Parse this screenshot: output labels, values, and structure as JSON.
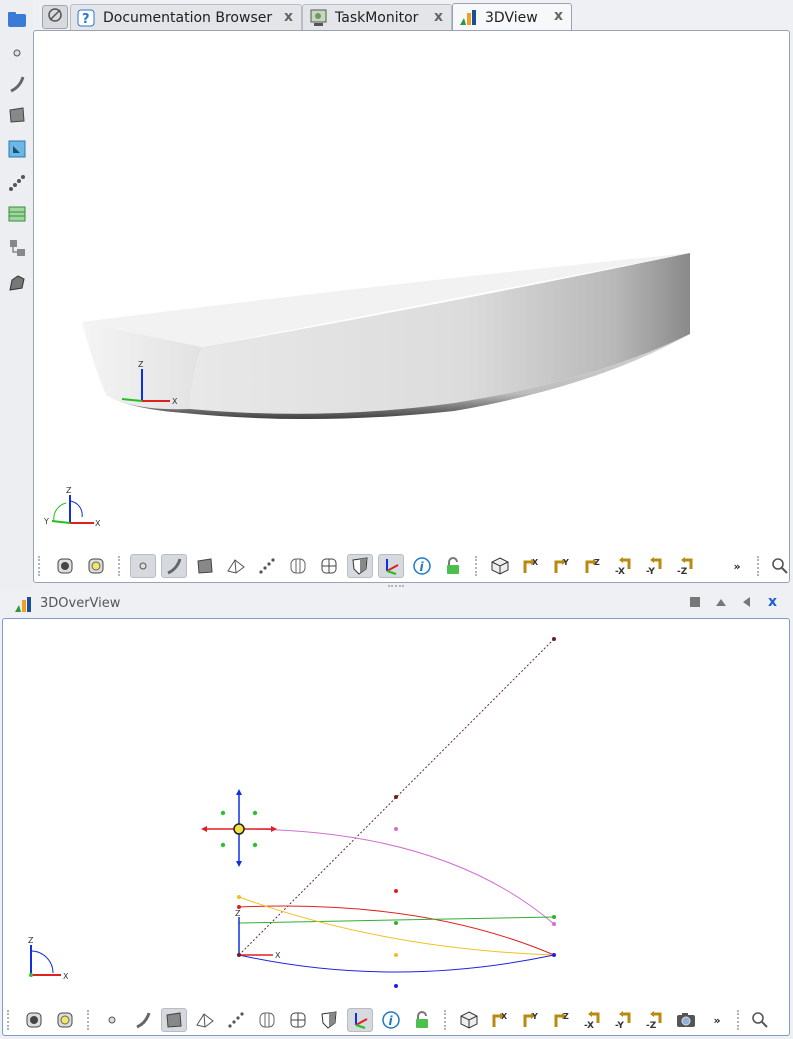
{
  "tabs": [
    {
      "label": "Documentation Browser",
      "icon": "help-icon"
    },
    {
      "label": "TaskMonitor",
      "icon": "monitor-icon"
    },
    {
      "label": "3DView",
      "icon": "view-bars-icon",
      "active": true
    }
  ],
  "main_view": {
    "axis_labels": {
      "x": "X",
      "y": "Y",
      "z": "Z"
    }
  },
  "overview": {
    "title": "3DOverView",
    "axis_labels": {
      "x": "X",
      "y": "Y",
      "z": "Z"
    }
  },
  "colors": {
    "accent": "#1a5fd6",
    "axis_x": "#e02020",
    "axis_y": "#20c020",
    "axis_z": "#1030e0",
    "curve_magenta": "#d070d0",
    "curve_red": "#e02020",
    "curve_green": "#30b030",
    "curve_yellow": "#f0c020",
    "curve_blue": "#2020e0"
  },
  "toolbar_labels": {
    "neg_x": "-X",
    "neg_y": "-Y",
    "neg_z": "-Z",
    "pos_x": "X",
    "pos_y": "Y",
    "pos_z": "Z",
    "more": "»"
  }
}
